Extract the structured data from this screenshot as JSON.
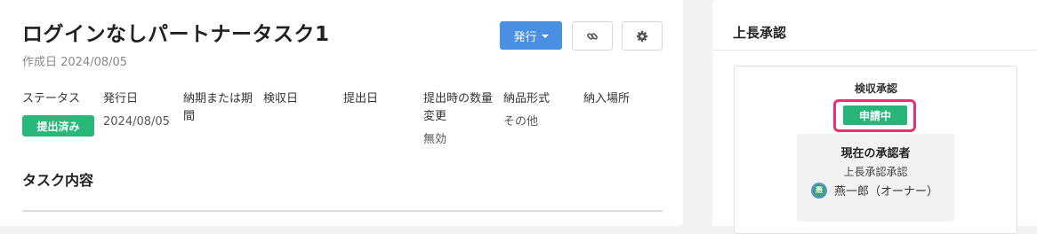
{
  "task": {
    "title": "ログインなしパートナータスク1",
    "created": "作成日 2024/08/05"
  },
  "toolbar": {
    "issue_label": "発行"
  },
  "columns": [
    {
      "header": "ステータス",
      "value": "提出済み"
    },
    {
      "header": "発行日",
      "value": "2024/08/05"
    },
    {
      "header": "納期または期間",
      "value": ""
    },
    {
      "header": "検収日",
      "value": ""
    },
    {
      "header": "提出日",
      "value": ""
    },
    {
      "header": "提出時の数量変更",
      "value": "無効"
    },
    {
      "header": "納品形式",
      "value": "その他"
    },
    {
      "header": "納入場所",
      "value": ""
    }
  ],
  "section": {
    "content_title": "タスク内容"
  },
  "approval": {
    "title": "上長承認",
    "step_label": "検収承認",
    "status": "申請中",
    "current_approver_title": "現在の承認者",
    "approver_role": "上長承認承認",
    "avatar_initial": "燕",
    "approver_name": "燕一郎（オーナー）"
  },
  "colors": {
    "primary": "#4a90e2",
    "success": "#28b87a",
    "highlight": "#ee2f6e"
  },
  "icons": {
    "link": "link-icon",
    "settings": "gear-icon",
    "dropdown": "caret-down-icon"
  }
}
